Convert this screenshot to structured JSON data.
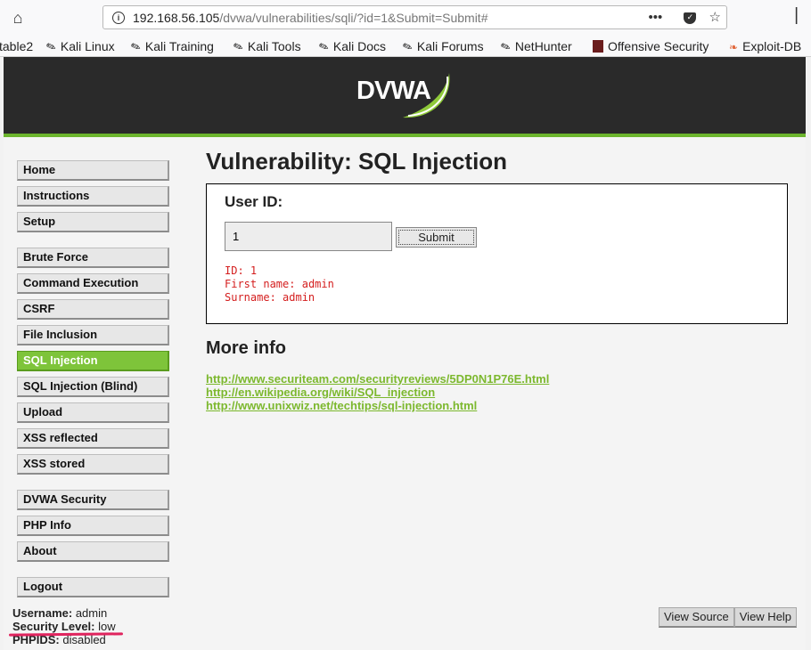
{
  "browser": {
    "url_host": "192.168.56.105",
    "url_path": "/dvwa/vulnerabilities/sqli/?id=1&Submit=Submit#",
    "bookmarks": [
      {
        "label": "table2",
        "icon": "none"
      },
      {
        "label": "Kali Linux",
        "icon": "kali-dragon-icon"
      },
      {
        "label": "Kali Training",
        "icon": "kali-dragon-icon"
      },
      {
        "label": "Kali Tools",
        "icon": "kali-dragon-icon"
      },
      {
        "label": "Kali Docs",
        "icon": "kali-dragon-icon"
      },
      {
        "label": "Kali Forums",
        "icon": "kali-dragon-icon"
      },
      {
        "label": "NetHunter",
        "icon": "kali-dragon-icon"
      },
      {
        "label": "Offensive Security",
        "icon": "offsec-icon"
      },
      {
        "label": "Exploit-DB",
        "icon": "exploitdb-icon"
      }
    ]
  },
  "header": {
    "logo_text": "DVWA"
  },
  "menu": {
    "blocks": [
      [
        {
          "label": "Home"
        },
        {
          "label": "Instructions"
        },
        {
          "label": "Setup"
        }
      ],
      [
        {
          "label": "Brute Force"
        },
        {
          "label": "Command Execution"
        },
        {
          "label": "CSRF"
        },
        {
          "label": "File Inclusion"
        },
        {
          "label": "SQL Injection",
          "selected": true
        },
        {
          "label": "SQL Injection (Blind)"
        },
        {
          "label": "Upload"
        },
        {
          "label": "XSS reflected"
        },
        {
          "label": "XSS stored"
        }
      ],
      [
        {
          "label": "DVWA Security"
        },
        {
          "label": "PHP Info"
        },
        {
          "label": "About"
        }
      ],
      [
        {
          "label": "Logout"
        }
      ]
    ]
  },
  "main": {
    "title": "Vulnerability: SQL Injection",
    "form": {
      "label": "User ID:",
      "input_value": "1",
      "submit_label": "Submit"
    },
    "result": {
      "id_label": "ID:",
      "id_value": "1",
      "first_label": "First name:",
      "first_value": "admin",
      "surname_label": "Surname:",
      "surname_value": "admin"
    },
    "more_info_title": "More info",
    "links": [
      "http://www.securiteam.com/securityreviews/5DP0N1P76E.html",
      "http://en.wikipedia.org/wiki/SQL_injection",
      "http://www.unixwiz.net/techtips/sql-injection.html"
    ]
  },
  "footer": {
    "username_label": "Username:",
    "username_value": "admin",
    "security_label": "Security Level:",
    "security_value": "low",
    "phpids_label": "PHPIDS:",
    "phpids_value": "disabled",
    "view_source_label": "View Source",
    "view_help_label": "View Help"
  },
  "colors": {
    "accent_green": "#7ec43a",
    "result_red": "#d41e1e",
    "header_bg": "#2a2a2a",
    "annotation_pink": "#e0245e"
  }
}
